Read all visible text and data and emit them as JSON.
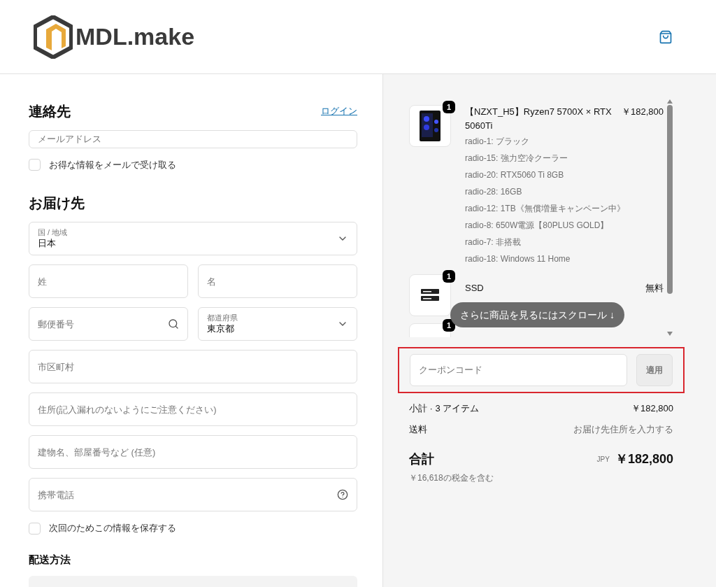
{
  "header": {
    "logo_text": "MDL.make"
  },
  "contact": {
    "title": "連絡先",
    "login_link": "ログイン",
    "email_placeholder": "メールアドレス",
    "newsletter": {
      "label": "お得な情報をメールで受け取る",
      "checked": false
    }
  },
  "shipping": {
    "title": "お届け先",
    "rows": [
      [
        {
          "kind": "select",
          "label": "国 / 地域",
          "value": "日本"
        }
      ],
      [
        {
          "kind": "text",
          "placeholder": "姓"
        },
        {
          "kind": "text",
          "placeholder": "名"
        }
      ],
      [
        {
          "kind": "search",
          "placeholder": "郵便番号"
        },
        {
          "kind": "select",
          "label": "都道府県",
          "value": "東京都"
        }
      ],
      [
        {
          "kind": "text",
          "placeholder": "市区町村"
        }
      ],
      [
        {
          "kind": "text",
          "placeholder": "住所(記入漏れのないようにご注意ください)"
        }
      ],
      [
        {
          "kind": "text",
          "placeholder": "建物名、部屋番号など (任意)"
        }
      ],
      [
        {
          "kind": "help",
          "placeholder": "携帯電話"
        }
      ]
    ],
    "save_info": {
      "label": "次回のためこの情報を保存する",
      "checked": false
    },
    "delivery_title": "配送方法"
  },
  "summary": {
    "items": [
      {
        "quantity": "1",
        "name": "【NZXT_H5】Ryzen7 5700X × RTX 5060Ti",
        "price": "￥182,800",
        "options": [
          "radio-1: ブラック",
          "radio-15: 強力空冷クーラー",
          "radio-20: RTX5060 Ti 8GB",
          "radio-28: 16GB",
          "radio-12: 1TB《無償増量キャンペーン中》",
          "radio-8: 650W電源【80PLUS GOLD】",
          "radio-7: 非搭載",
          "radio-18: Windows 11 Home"
        ]
      },
      {
        "kind": "storage",
        "quantity": "1",
        "name": "SSD",
        "price": "無料"
      },
      {
        "kind": "blank",
        "quantity": "1"
      }
    ],
    "scroll_hint": "さらに商品を見るにはスクロール ↓",
    "coupon": {
      "placeholder": "クーポンコード",
      "button": "適用",
      "highlighted": true
    },
    "subtotal": {
      "label": "小計 · 3 アイテム",
      "value": "￥182,800"
    },
    "shipping": {
      "label": "送料",
      "value": "お届け先住所を入力する"
    },
    "total": {
      "label": "合計",
      "currency": "JPY",
      "value": "￥182,800"
    },
    "tax_note": "￥16,618の税金を含む"
  }
}
